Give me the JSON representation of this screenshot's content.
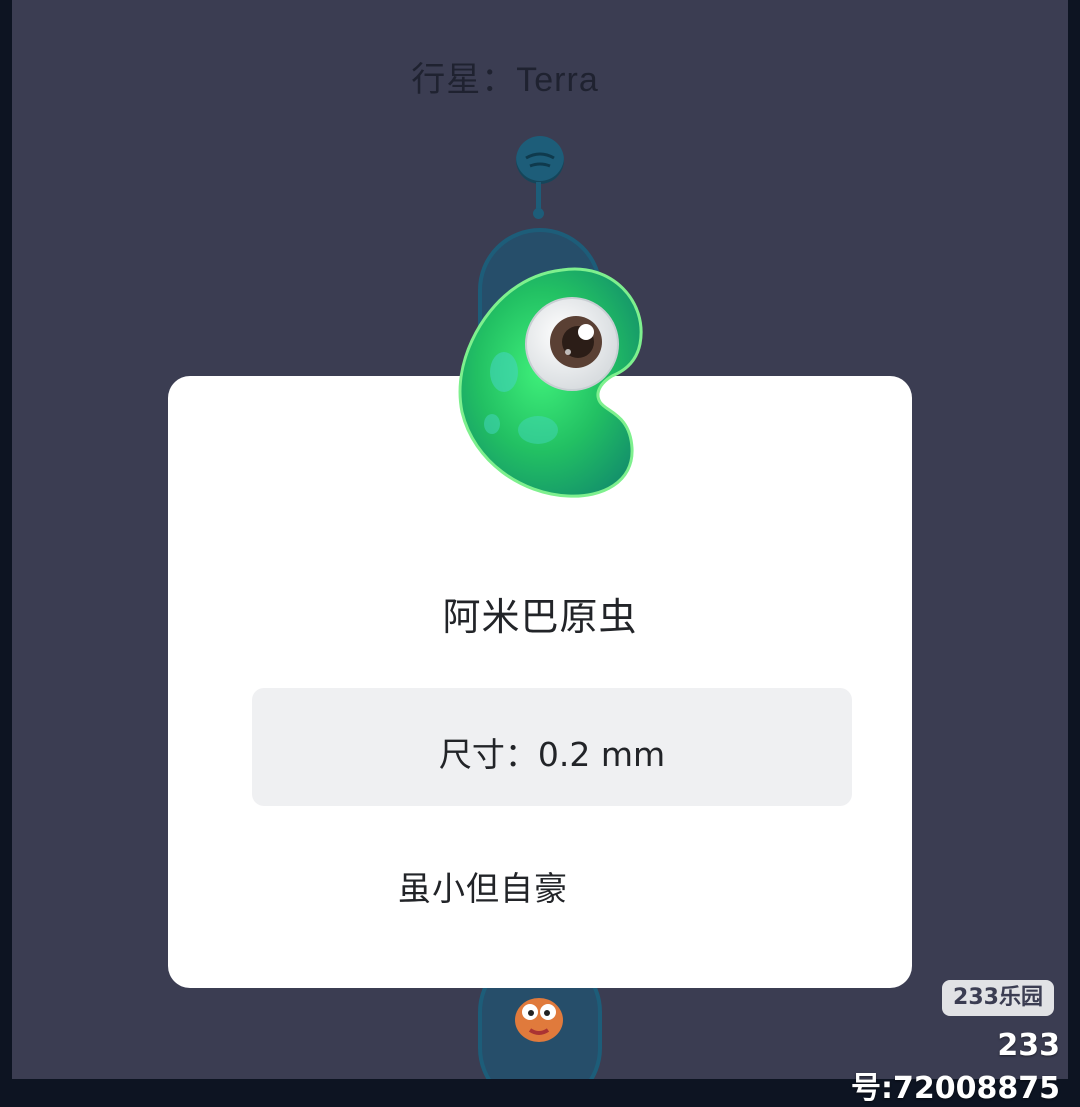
{
  "header": {
    "planet_label": "行星：",
    "planet_name": "Terra"
  },
  "card": {
    "creature_name": "阿米巴原虫",
    "size_label": "尺寸：",
    "size_value": "0.2 mm",
    "motto": "虽小但自豪"
  },
  "watermark": {
    "logo": "233乐园",
    "id_text": "233号:72008875"
  },
  "icons": {
    "planet_node": "planet-node-icon",
    "creature": "amoeba-creature-icon",
    "next_creature": "next-creature-icon"
  },
  "colors": {
    "background": "#3b3d52",
    "node": "#1d5d79",
    "card": "#ffffff",
    "info_box": "#eff0f2",
    "creature_green": "#2fd46b"
  }
}
